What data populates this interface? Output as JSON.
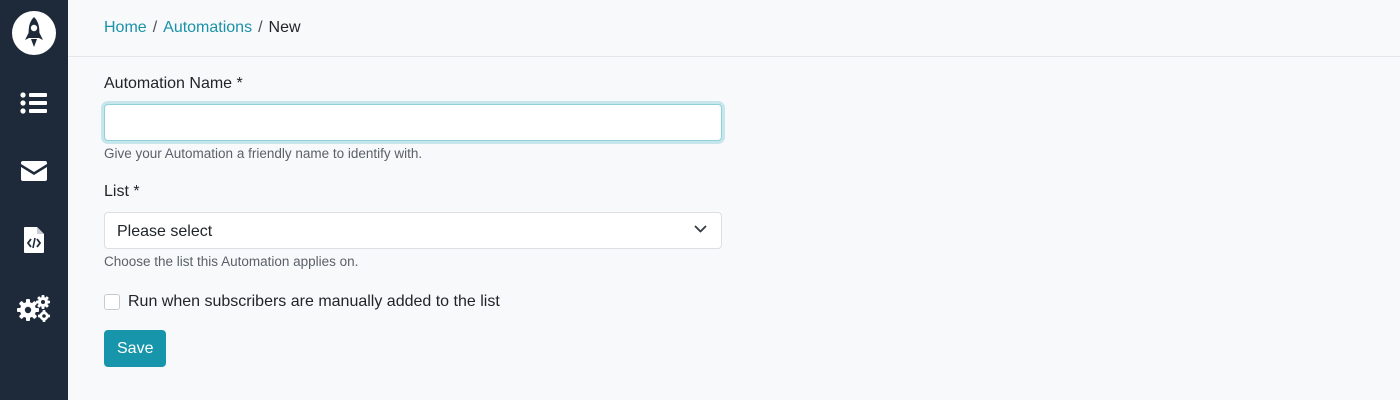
{
  "breadcrumb": {
    "home": "Home",
    "separator": "/",
    "automations": "Automations",
    "current": "New"
  },
  "sidebar": {
    "items": [
      {
        "icon": "list-icon"
      },
      {
        "icon": "envelope-icon"
      },
      {
        "icon": "code-file-icon"
      },
      {
        "icon": "gears-icon"
      }
    ]
  },
  "form": {
    "name_label": "Automation Name *",
    "name_value": "",
    "name_help": "Give your Automation a friendly name to identify with.",
    "list_label": "List *",
    "list_selected": "Please select",
    "list_help": "Choose the list this Automation applies on.",
    "manual_checkbox_label": "Run when subscribers are manually added to the list",
    "manual_checkbox_checked": false,
    "save_label": "Save"
  },
  "colors": {
    "sidebar": "#1e2a3a",
    "accent": "#1796ab",
    "link": "#1a93a8"
  }
}
